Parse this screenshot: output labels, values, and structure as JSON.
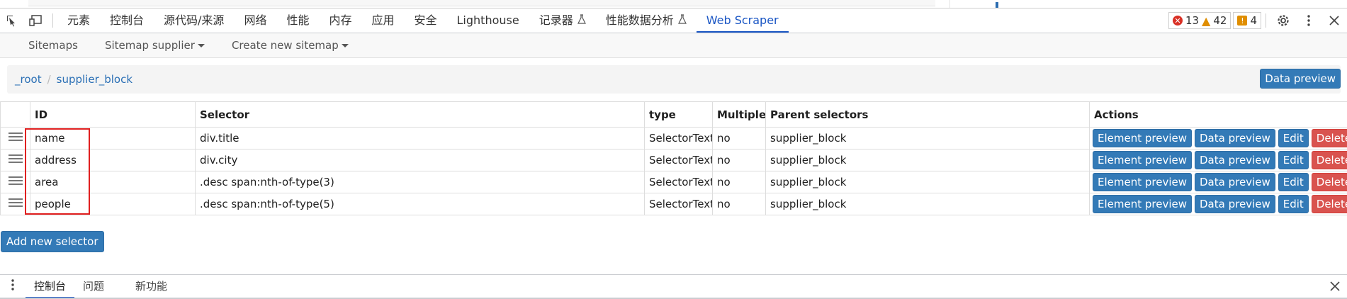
{
  "devtools": {
    "tabs": [
      {
        "label": "元素"
      },
      {
        "label": "控制台"
      },
      {
        "label": "源代码/来源"
      },
      {
        "label": "网络"
      },
      {
        "label": "性能"
      },
      {
        "label": "内存"
      },
      {
        "label": "应用"
      },
      {
        "label": "安全"
      },
      {
        "label": "Lighthouse"
      },
      {
        "label": "记录器",
        "experimental": true
      },
      {
        "label": "性能数据分析",
        "experimental": true
      },
      {
        "label": "Web Scraper",
        "active": true
      }
    ],
    "counts": {
      "errors": "13",
      "warnings": "42",
      "issues": "4"
    },
    "icons": {
      "error": "✕",
      "warning": "▲",
      "issue": "!"
    }
  },
  "scraper_nav": {
    "sitemaps": "Sitemaps",
    "sitemap_menu": "Sitemap supplier",
    "create": "Create new sitemap"
  },
  "breadcrumb": {
    "root": "_root",
    "current": "supplier_block",
    "data_preview": "Data preview"
  },
  "table": {
    "headers": {
      "id": "ID",
      "selector": "Selector",
      "type": "type",
      "multiple": "Multiple",
      "parent": "Parent selectors",
      "actions": "Actions"
    },
    "rows": [
      {
        "id": "name",
        "selector": "div.title",
        "type": "SelectorText",
        "multiple": "no",
        "parent": "supplier_block"
      },
      {
        "id": "address",
        "selector": "div.city",
        "type": "SelectorText",
        "multiple": "no",
        "parent": "supplier_block"
      },
      {
        "id": "area",
        "selector": ".desc span:nth-of-type(3)",
        "type": "SelectorText",
        "multiple": "no",
        "parent": "supplier_block"
      },
      {
        "id": "people",
        "selector": ".desc span:nth-of-type(5)",
        "type": "SelectorText",
        "multiple": "no",
        "parent": "supplier_block"
      }
    ],
    "action_labels": {
      "element_preview": "Element preview",
      "data_preview": "Data preview",
      "edit": "Edit",
      "delete": "Delete"
    }
  },
  "add_selector": "Add new selector",
  "drawer": {
    "tabs": [
      {
        "label": "控制台",
        "active": true
      },
      {
        "label": "问题"
      },
      {
        "label": "新功能"
      }
    ]
  },
  "colors": {
    "accent": "#1a56c4",
    "primary_button": "#337ab7",
    "danger_button": "#d9534f",
    "highlight_box": "#e02020"
  }
}
